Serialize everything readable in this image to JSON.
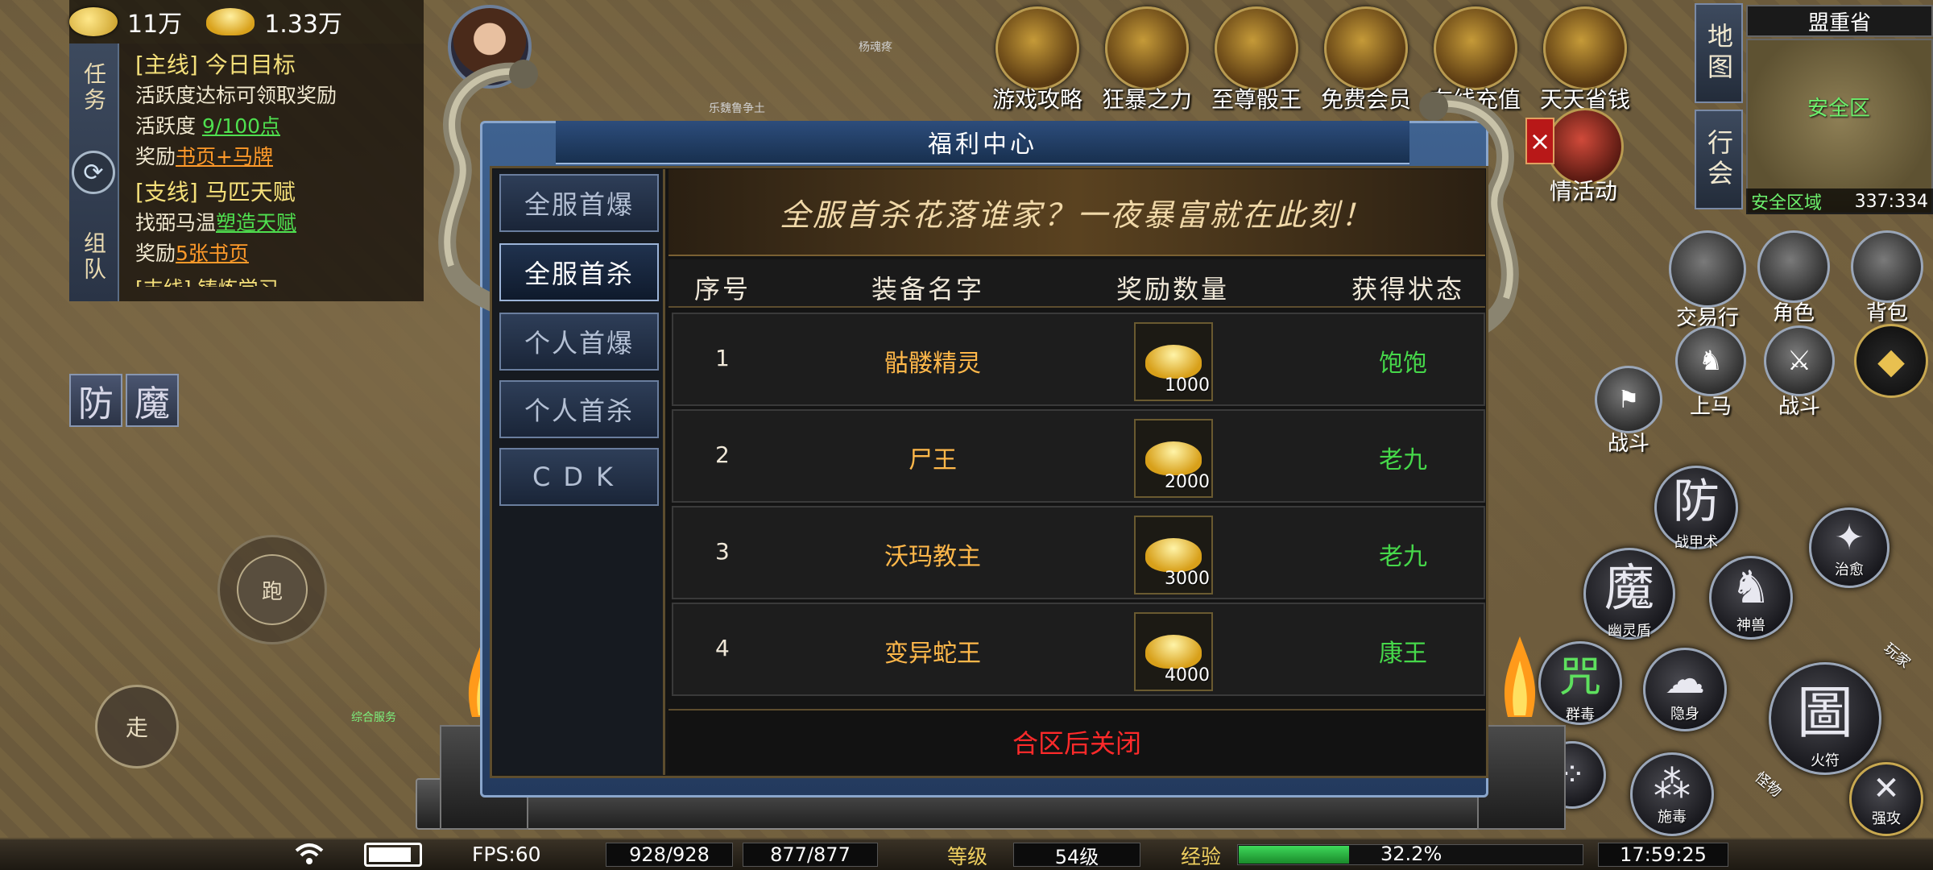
{
  "resources": {
    "gold": "11万",
    "ingot": "1.33万"
  },
  "quest_tabs": {
    "task": "任务",
    "team": "组队"
  },
  "quests": [
    {
      "type": "[主线]",
      "title": "今日目标",
      "lines": [
        {
          "plain": "活跃度达标可领取奖励"
        },
        {
          "prefix": "活跃度 ",
          "value": "9/100点",
          "style": "green"
        },
        {
          "prefix": "奖励",
          "value": "书页+马牌",
          "style": "orange"
        }
      ]
    },
    {
      "type": "[支线]",
      "title": "马匹天赋",
      "lines": [
        {
          "prefix": "找弼马温",
          "value": "塑造天赋",
          "style": "green"
        },
        {
          "prefix": "奖励",
          "value": "5张书页",
          "style": "orange"
        }
      ]
    }
  ],
  "quest_cut": "[支线] 铸炼学习",
  "side_buttons_left": {
    "defense": "防",
    "magic": "魔"
  },
  "joystick": {
    "run": "跑",
    "walk": "走"
  },
  "npcs": {
    "n1": "杨魂疼",
    "n2": "乐魏鲁争土",
    "n3": "综合服务"
  },
  "top_icons": [
    {
      "label": "游戏攻略",
      "icon": "guide-icon"
    },
    {
      "label": "狂暴之力",
      "icon": "rage-icon"
    },
    {
      "label": "至尊骰王",
      "icon": "dice-king-icon"
    },
    {
      "label": "免费会员",
      "icon": "vip-icon"
    },
    {
      "label": "在线充值",
      "icon": "recharge-icon"
    },
    {
      "label": "天天省钱",
      "icon": "gift-icon"
    }
  ],
  "event_label": "情活动",
  "nav": {
    "map": "地图",
    "guild": "行会"
  },
  "minimap": {
    "title": "盟重省",
    "safe_label": "安全区",
    "zone": "安全区域",
    "coords": "337:334"
  },
  "right_buttons": {
    "trade": "交易行",
    "character": "角色",
    "bag": "背包",
    "mount": "上马",
    "battle": "战斗",
    "battle2": "战斗"
  },
  "skills": {
    "defense": {
      "glyph": "防",
      "label": "战甲术"
    },
    "heal": {
      "glyph": "✦",
      "label": "治愈"
    },
    "ghost": {
      "glyph": "魔",
      "label": "幽灵盾"
    },
    "beast": {
      "glyph": "♞",
      "label": "神兽"
    },
    "poison_group": {
      "glyph": "咒",
      "label": "群毒"
    },
    "stealth": {
      "glyph": "☁",
      "label": "隐身"
    },
    "talisman": {
      "glyph": "圖",
      "label": "火符"
    },
    "cast_poison": {
      "glyph": "⁂",
      "label": "施毒"
    },
    "strong_attack": {
      "glyph": "✕",
      "label": "强攻"
    },
    "play": "玩家",
    "monster": "怪物"
  },
  "status_bar": {
    "fps": "FPS:60",
    "hp": "928/928",
    "mp": "877/877",
    "level_label": "等级",
    "level": "54级",
    "exp_label": "经验",
    "exp_percent": "32.2%",
    "exp_fraction": 0.322,
    "time": "17:59:25"
  },
  "modal": {
    "title": "福利中心",
    "close": "×",
    "tabs": [
      {
        "label": "全服首爆",
        "active": false
      },
      {
        "label": "全服首杀",
        "active": true
      },
      {
        "label": "个人首爆",
        "active": false
      },
      {
        "label": "个人首杀",
        "active": false
      },
      {
        "label": "CDK",
        "active": false
      }
    ],
    "banner": "全服首杀花落谁家？一夜暴富就在此刻！",
    "headers": {
      "idx": "序号",
      "name": "装备名字",
      "reward": "奖励数量",
      "status": "获得状态"
    },
    "rows": [
      {
        "idx": "1",
        "name": "骷髅精灵",
        "qty": "1000",
        "status": "饱饱"
      },
      {
        "idx": "2",
        "name": "尸王",
        "qty": "2000",
        "status": "老九"
      },
      {
        "idx": "3",
        "name": "沃玛教主",
        "qty": "3000",
        "status": "老九"
      },
      {
        "idx": "4",
        "name": "变异蛇王",
        "qty": "4000",
        "status": "康王"
      }
    ],
    "footer": "合区后关闭"
  }
}
